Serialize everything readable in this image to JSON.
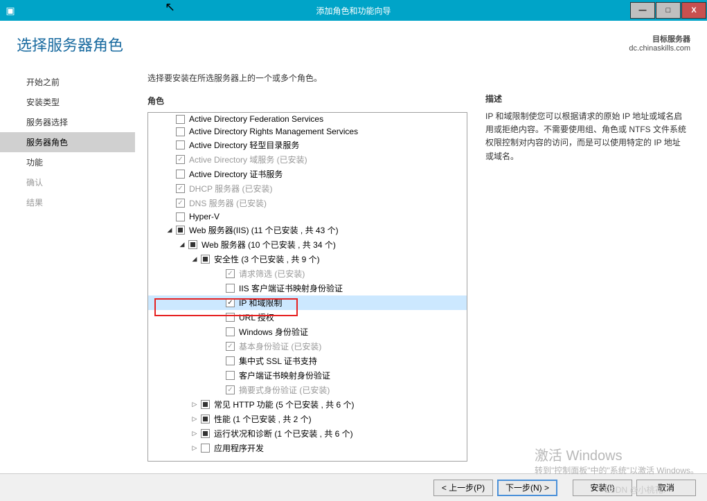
{
  "window": {
    "title": "添加角色和功能向导",
    "controls": {
      "min": "—",
      "max": "□",
      "close": "X"
    }
  },
  "header": {
    "page_title": "选择服务器角色",
    "target_label": "目标服务器",
    "target_value": "dc.chinaskills.com"
  },
  "sidebar": {
    "steps": [
      {
        "label": "开始之前",
        "state": ""
      },
      {
        "label": "安装类型",
        "state": ""
      },
      {
        "label": "服务器选择",
        "state": ""
      },
      {
        "label": "服务器角色",
        "state": "active"
      },
      {
        "label": "功能",
        "state": ""
      },
      {
        "label": "确认",
        "state": "disabled"
      },
      {
        "label": "结果",
        "state": "disabled"
      }
    ]
  },
  "main": {
    "instruction": "选择要安装在所选服务器上的一个或多个角色。",
    "roles_label": "角色",
    "desc_label": "描述",
    "description": "IP 和域限制使您可以根据请求的原始 IP 地址或域名启用或拒绝内容。不需要使用组、角色或 NTFS 文件系统权限控制对内容的访问，而是可以使用特定的 IP 地址或域名。",
    "tree": [
      {
        "indent": 2,
        "expander": "",
        "check": "unchecked",
        "label": "Active Directory Federation Services",
        "disabled": false
      },
      {
        "indent": 2,
        "expander": "",
        "check": "unchecked",
        "label": "Active Directory Rights Management Services",
        "disabled": false
      },
      {
        "indent": 2,
        "expander": "",
        "check": "unchecked",
        "label": "Active Directory 轻型目录服务",
        "disabled": false
      },
      {
        "indent": 2,
        "expander": "",
        "check": "checked",
        "label": "Active Directory 域服务 (已安装)",
        "disabled": true
      },
      {
        "indent": 2,
        "expander": "",
        "check": "unchecked",
        "label": "Active Directory 证书服务",
        "disabled": false
      },
      {
        "indent": 2,
        "expander": "",
        "check": "checked",
        "label": "DHCP 服务器 (已安装)",
        "disabled": true
      },
      {
        "indent": 2,
        "expander": "",
        "check": "checked",
        "label": "DNS 服务器 (已安装)",
        "disabled": true
      },
      {
        "indent": 2,
        "expander": "",
        "check": "unchecked",
        "label": "Hyper-V",
        "disabled": false
      },
      {
        "indent": 2,
        "expander": "▲",
        "check": "partial",
        "label": "Web 服务器(IIS) (11 个已安装 , 共 43 个)",
        "disabled": false
      },
      {
        "indent": 3,
        "expander": "▲",
        "check": "partial",
        "label": "Web 服务器 (10 个已安装 , 共 34 个)",
        "disabled": false
      },
      {
        "indent": 4,
        "expander": "▲",
        "check": "partial",
        "label": "安全性 (3 个已安装 , 共 9 个)",
        "disabled": false
      },
      {
        "indent": 6,
        "expander": "",
        "check": "checked",
        "label": "请求筛选 (已安装)",
        "disabled": true
      },
      {
        "indent": 6,
        "expander": "",
        "check": "unchecked",
        "label": "IIS 客户端证书映射身份验证",
        "disabled": false
      },
      {
        "indent": 6,
        "expander": "",
        "check": "checked",
        "label": "IP 和域限制",
        "disabled": false,
        "selected": true
      },
      {
        "indent": 6,
        "expander": "",
        "check": "unchecked",
        "label": "URL 授权",
        "disabled": false
      },
      {
        "indent": 6,
        "expander": "",
        "check": "unchecked",
        "label": "Windows 身份验证",
        "disabled": false
      },
      {
        "indent": 6,
        "expander": "",
        "check": "checked",
        "label": "基本身份验证 (已安装)",
        "disabled": true
      },
      {
        "indent": 6,
        "expander": "",
        "check": "unchecked",
        "label": "集中式 SSL 证书支持",
        "disabled": false
      },
      {
        "indent": 6,
        "expander": "",
        "check": "unchecked",
        "label": "客户端证书映射身份验证",
        "disabled": false
      },
      {
        "indent": 6,
        "expander": "",
        "check": "checked",
        "label": "摘要式身份验证 (已安装)",
        "disabled": true
      },
      {
        "indent": 4,
        "expander": "▷",
        "check": "partial",
        "label": "常见 HTTP 功能 (5 个已安装 , 共 6 个)",
        "disabled": false
      },
      {
        "indent": 4,
        "expander": "▷",
        "check": "partial",
        "label": "性能 (1 个已安装 , 共 2 个)",
        "disabled": false
      },
      {
        "indent": 4,
        "expander": "▷",
        "check": "partial",
        "label": "运行状况和诊断 (1 个已安装 , 共 6 个)",
        "disabled": false
      },
      {
        "indent": 4,
        "expander": "▷",
        "check": "unchecked",
        "label": "应用程序开发",
        "disabled": false
      }
    ]
  },
  "footer": {
    "prev": "< 上一步(P)",
    "next": "下一步(N) >",
    "install": "安装(I)",
    "cancel": "取消"
  },
  "watermark": {
    "title": "激活 Windows",
    "sub": "转到\"控制面板\"中的\"系统\"以激活 Windows。",
    "csdn": "CSDN @小桃花."
  }
}
